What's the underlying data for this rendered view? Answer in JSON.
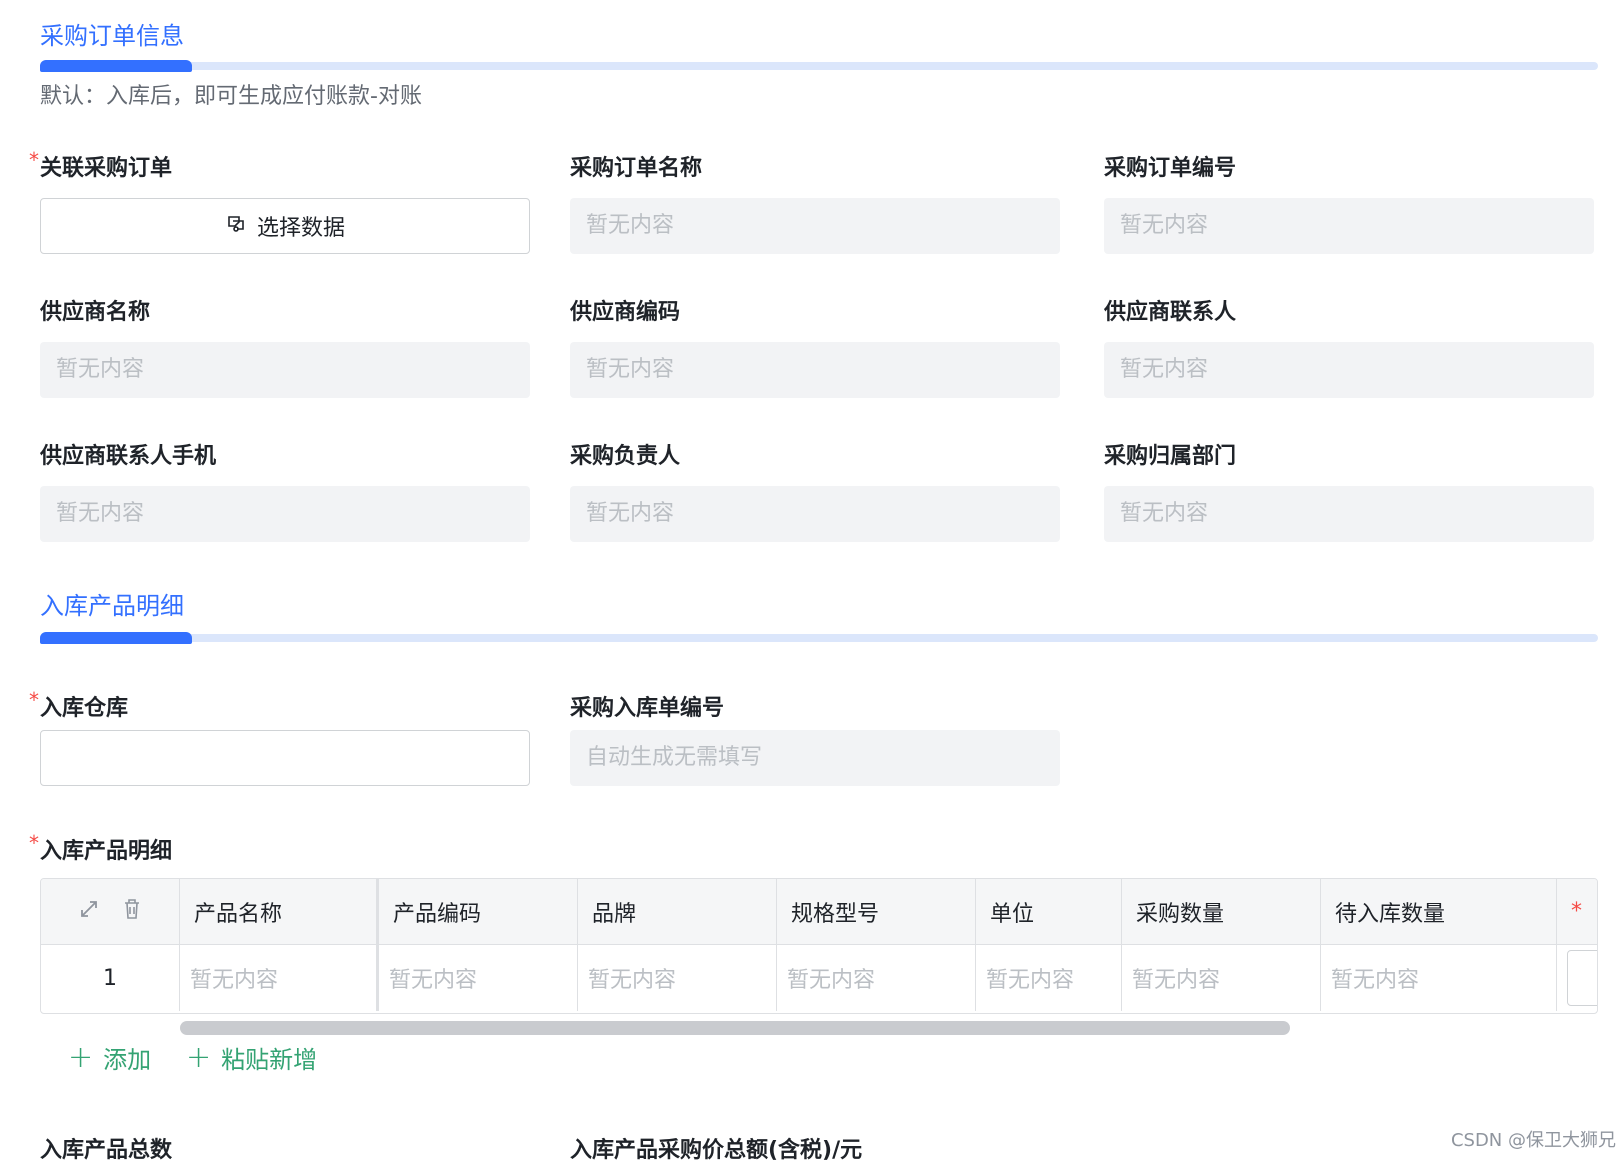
{
  "section1": {
    "title": "采购订单信息",
    "hint": "默认：入库后，即可生成应付账款-对账"
  },
  "fields": {
    "related_po": {
      "label": "关联采购订单",
      "required": "*",
      "button": "选择数据"
    },
    "po_name": {
      "label": "采购订单名称",
      "value": "暂无内容"
    },
    "po_code": {
      "label": "采购订单编号",
      "value": "暂无内容"
    },
    "supplier_name": {
      "label": "供应商名称",
      "value": "暂无内容"
    },
    "supplier_code": {
      "label": "供应商编码",
      "value": "暂无内容"
    },
    "supplier_contact": {
      "label": "供应商联系人",
      "value": "暂无内容"
    },
    "supplier_phone": {
      "label": "供应商联系人手机",
      "value": "暂无内容"
    },
    "po_owner": {
      "label": "采购负责人",
      "value": "暂无内容"
    },
    "po_dept": {
      "label": "采购归属部门",
      "value": "暂无内容"
    }
  },
  "section2": {
    "title": "入库产品明细"
  },
  "inbound": {
    "warehouse": {
      "label": "入库仓库",
      "required": "*"
    },
    "inbound_code": {
      "label": "采购入库单编号",
      "value": "自动生成无需填写"
    },
    "detail": {
      "label": "入库产品明细",
      "required": "*"
    }
  },
  "table": {
    "headers": [
      "产品名称",
      "产品编码",
      "品牌",
      "规格型号",
      "单位",
      "采购数量",
      "待入库数量"
    ],
    "last_header_star": "*",
    "row_index": "1",
    "row_values": [
      "暂无内容",
      "暂无内容",
      "暂无内容",
      "暂无内容",
      "暂无内容",
      "暂无内容",
      "暂无内容"
    ]
  },
  "actions": {
    "add": "添加",
    "paste_add": "粘贴新增"
  },
  "totals": {
    "total_count_label": "入库产品总数",
    "total_amount_label": "入库产品采购价总额(含税)/元"
  },
  "watermark": "CSDN @保卫大狮兄",
  "colors": {
    "accent": "#3370ff",
    "required": "#f54a45",
    "add_green": "#34a373"
  }
}
